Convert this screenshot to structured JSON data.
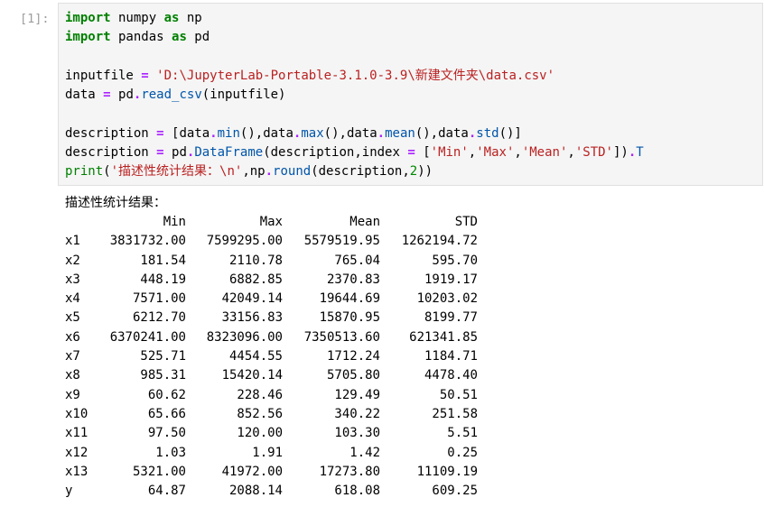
{
  "prompt": "[1]:",
  "code_lines": [
    [
      {
        "t": "import",
        "c": "kw"
      },
      {
        "t": " numpy ",
        "c": ""
      },
      {
        "t": "as",
        "c": "kw"
      },
      {
        "t": " np",
        "c": ""
      }
    ],
    [
      {
        "t": "import",
        "c": "kw"
      },
      {
        "t": " pandas ",
        "c": ""
      },
      {
        "t": "as",
        "c": "kw"
      },
      {
        "t": " pd",
        "c": ""
      }
    ],
    [],
    [
      {
        "t": "inputfile ",
        "c": ""
      },
      {
        "t": "=",
        "c": "op"
      },
      {
        "t": " ",
        "c": ""
      },
      {
        "t": "'D:\\JupyterLab-Portable-3.1.0-3.9\\新建文件夹\\data.csv'",
        "c": "str"
      }
    ],
    [
      {
        "t": "data ",
        "c": ""
      },
      {
        "t": "=",
        "c": "op"
      },
      {
        "t": " pd",
        "c": ""
      },
      {
        "t": ".",
        "c": "op"
      },
      {
        "t": "read_csv",
        "c": "attr"
      },
      {
        "t": "(inputfile)",
        "c": ""
      }
    ],
    [],
    [
      {
        "t": "description ",
        "c": ""
      },
      {
        "t": "=",
        "c": "op"
      },
      {
        "t": " [data",
        "c": ""
      },
      {
        "t": ".",
        "c": "op"
      },
      {
        "t": "min",
        "c": "attr"
      },
      {
        "t": "(),data",
        "c": ""
      },
      {
        "t": ".",
        "c": "op"
      },
      {
        "t": "max",
        "c": "attr"
      },
      {
        "t": "(),data",
        "c": ""
      },
      {
        "t": ".",
        "c": "op"
      },
      {
        "t": "mean",
        "c": "attr"
      },
      {
        "t": "(),data",
        "c": ""
      },
      {
        "t": ".",
        "c": "op"
      },
      {
        "t": "std",
        "c": "attr"
      },
      {
        "t": "()]",
        "c": ""
      }
    ],
    [
      {
        "t": "description ",
        "c": ""
      },
      {
        "t": "=",
        "c": "op"
      },
      {
        "t": " pd",
        "c": ""
      },
      {
        "t": ".",
        "c": "op"
      },
      {
        "t": "DataFrame",
        "c": "attr"
      },
      {
        "t": "(description,index ",
        "c": ""
      },
      {
        "t": "=",
        "c": "op"
      },
      {
        "t": " [",
        "c": ""
      },
      {
        "t": "'Min'",
        "c": "str"
      },
      {
        "t": ",",
        "c": ""
      },
      {
        "t": "'Max'",
        "c": "str"
      },
      {
        "t": ",",
        "c": ""
      },
      {
        "t": "'Mean'",
        "c": "str"
      },
      {
        "t": ",",
        "c": ""
      },
      {
        "t": "'STD'",
        "c": "str"
      },
      {
        "t": "])",
        "c": ""
      },
      {
        "t": ".",
        "c": "op"
      },
      {
        "t": "T",
        "c": "attr"
      }
    ],
    [
      {
        "t": "print",
        "c": "bi"
      },
      {
        "t": "(",
        "c": ""
      },
      {
        "t": "'描述性统计结果：\\n'",
        "c": "str"
      },
      {
        "t": ",np",
        "c": ""
      },
      {
        "t": ".",
        "c": "op"
      },
      {
        "t": "round",
        "c": "attr"
      },
      {
        "t": "(description,",
        "c": ""
      },
      {
        "t": "2",
        "c": "num"
      },
      {
        "t": "))",
        "c": ""
      }
    ]
  ],
  "output": {
    "title": "描述性统计结果：",
    "columns": [
      "Min",
      "Max",
      "Mean",
      "STD"
    ],
    "rows": [
      {
        "index": "x1",
        "values": [
          "3831732.00",
          "7599295.00",
          "5579519.95",
          "1262194.72"
        ]
      },
      {
        "index": "x2",
        "values": [
          "181.54",
          "2110.78",
          "765.04",
          "595.70"
        ]
      },
      {
        "index": "x3",
        "values": [
          "448.19",
          "6882.85",
          "2370.83",
          "1919.17"
        ]
      },
      {
        "index": "x4",
        "values": [
          "7571.00",
          "42049.14",
          "19644.69",
          "10203.02"
        ]
      },
      {
        "index": "x5",
        "values": [
          "6212.70",
          "33156.83",
          "15870.95",
          "8199.77"
        ]
      },
      {
        "index": "x6",
        "values": [
          "6370241.00",
          "8323096.00",
          "7350513.60",
          "621341.85"
        ]
      },
      {
        "index": "x7",
        "values": [
          "525.71",
          "4454.55",
          "1712.24",
          "1184.71"
        ]
      },
      {
        "index": "x8",
        "values": [
          "985.31",
          "15420.14",
          "5705.80",
          "4478.40"
        ]
      },
      {
        "index": "x9",
        "values": [
          "60.62",
          "228.46",
          "129.49",
          "50.51"
        ]
      },
      {
        "index": "x10",
        "values": [
          "65.66",
          "852.56",
          "340.22",
          "251.58"
        ]
      },
      {
        "index": "x11",
        "values": [
          "97.50",
          "120.00",
          "103.30",
          "5.51"
        ]
      },
      {
        "index": "x12",
        "values": [
          "1.03",
          "1.91",
          "1.42",
          "0.25"
        ]
      },
      {
        "index": "x13",
        "values": [
          "5321.00",
          "41972.00",
          "17273.80",
          "11109.19"
        ]
      },
      {
        "index": "y",
        "values": [
          "64.87",
          "2088.14",
          "618.08",
          "609.25"
        ]
      }
    ]
  }
}
